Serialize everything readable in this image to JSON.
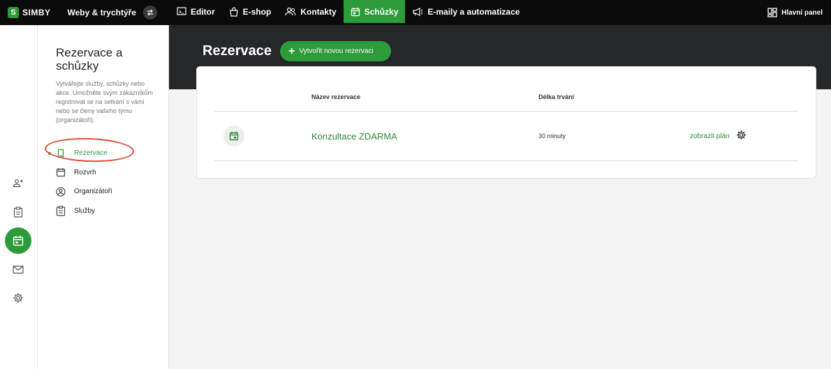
{
  "brand": {
    "name": "SIMBY",
    "badge": "S"
  },
  "site": {
    "name": "Weby & trychtýře"
  },
  "nav": [
    {
      "label": "Editor",
      "icon": "editor-icon"
    },
    {
      "label": "E-shop",
      "icon": "shopping-bag-icon"
    },
    {
      "label": "Kontakty",
      "icon": "contacts-icon"
    },
    {
      "label": "Schůzky",
      "icon": "calendar-icon",
      "active": true
    },
    {
      "label": "E-maily a automatizace",
      "icon": "megaphone-icon"
    }
  ],
  "dashboard": {
    "label": "Hlavní panel"
  },
  "sidebar": {
    "title": "Rezervace a schůzky",
    "description": "Vytvářejte služby, schůzky nebo akce. Umožněte svým zákazníkům registrovat se na setkání s vámi nebo se členy vašeho týmu (organizátoři).",
    "items": [
      {
        "label": "Rezervace",
        "icon": "bookmark-icon",
        "active": true
      },
      {
        "label": "Rozvrh",
        "icon": "calendar-icon"
      },
      {
        "label": "Organizátoři",
        "icon": "user-circle-icon"
      },
      {
        "label": "Služby",
        "icon": "clipboard-icon"
      }
    ]
  },
  "main": {
    "title": "Rezervace",
    "create_label": "Vytvořit novou rezervaci",
    "table": {
      "headers": [
        "Název rezervace",
        "Délka trvání"
      ],
      "rows": [
        {
          "name": "Konzultace ZDARMA",
          "duration": "30 minuty",
          "link": "zobrazit plán"
        }
      ]
    }
  },
  "colors": {
    "accent": "#2e9b3b",
    "topbar": "#0b0b0b",
    "header": "#26272b",
    "annotation": "#e04a3a"
  }
}
